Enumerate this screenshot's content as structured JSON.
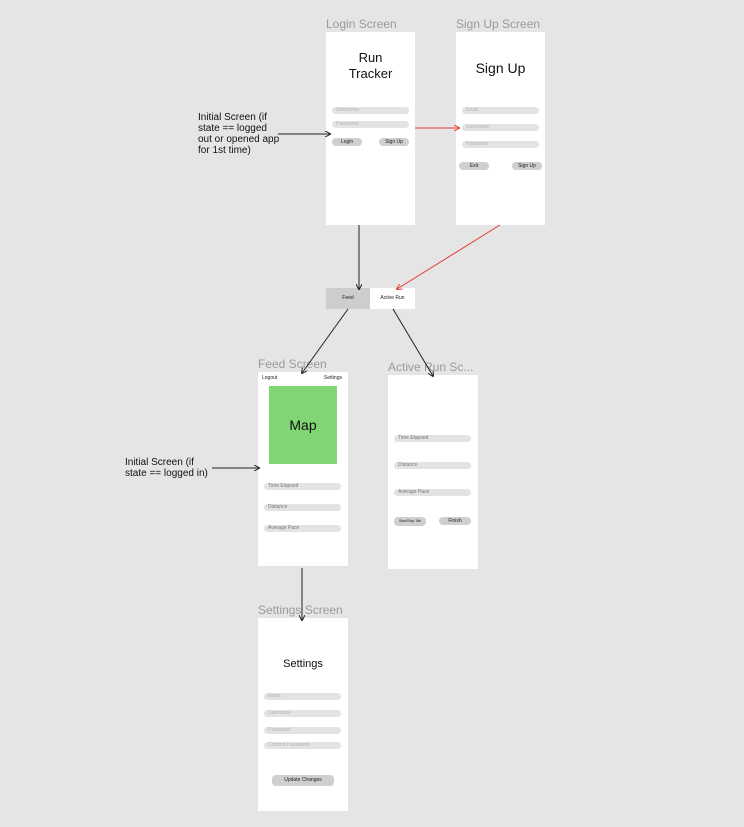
{
  "frames": {
    "login": {
      "label": "Login Screen",
      "title_line1": "Run",
      "title_line2": "Tracker",
      "username_placeholder": "Username",
      "password_placeholder": "Password",
      "login_label": "Login",
      "signup_label": "Sign Up"
    },
    "signup": {
      "label": "Sign Up Screen",
      "title": "Sign Up",
      "email_placeholder": "Email",
      "username_placeholder": "Username",
      "password_placeholder": "Password",
      "exit_label": "Exit",
      "signup_label": "Sign Up"
    },
    "tabbar": {
      "feed_label": "Feed",
      "active_run_label": "Active Run"
    },
    "feed": {
      "label": "Feed Screen",
      "logout_label": "Logout",
      "settings_label": "Settings",
      "map_label": "Map",
      "map_color": "#7fd672",
      "time_elapsed": "Time Elapsed",
      "distance": "Distance",
      "average_pace": "Average Pace"
    },
    "active_run": {
      "label": "Active Run Sc...",
      "time_elapsed": "Time Elapsed",
      "distance": "Distance",
      "average_pace": "Average Pace",
      "start_stop_label": "Start/Stop Tab",
      "finish_label": "Finish"
    },
    "settings": {
      "label": "Settings Screen",
      "title": "Settings",
      "email_placeholder": "Email",
      "username_placeholder": "Username",
      "password_placeholder": "Password",
      "confirm_password_placeholder": "Confirm Password",
      "update_label": "Update Changes"
    }
  },
  "notes": {
    "initial_logged_out": "Initial Screen (if state == logged out or opened app for 1st time)",
    "initial_logged_in": "Initial Screen (if state == logged in)"
  },
  "colors": {
    "background": "#e5e5e5",
    "arrow_black": "#222222",
    "arrow_red": "#e53935"
  }
}
